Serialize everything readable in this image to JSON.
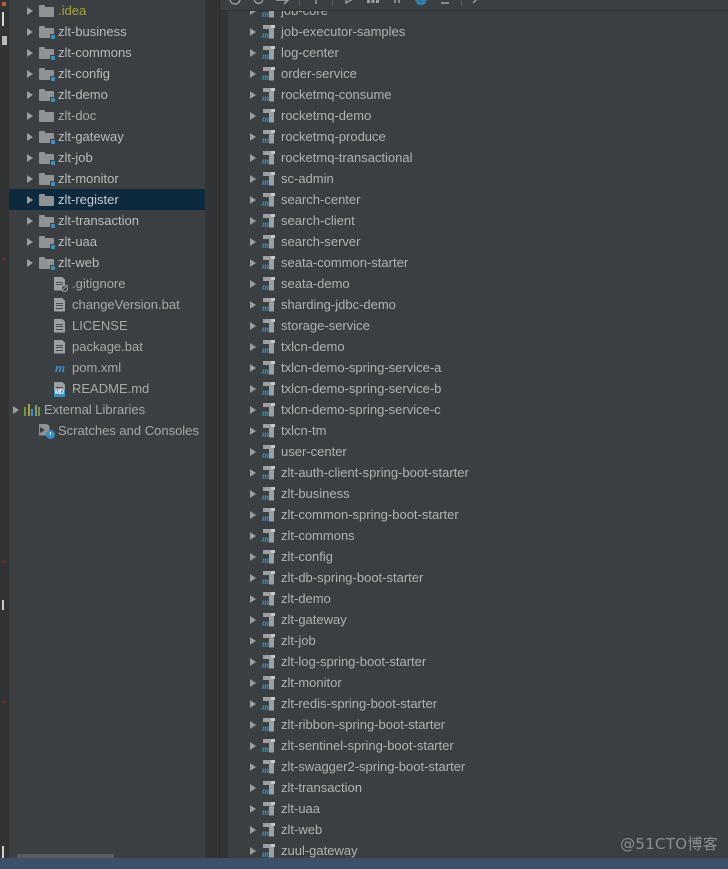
{
  "watermark": "@51CTO博客",
  "left_panel": {
    "name": "project-tree",
    "scrollbar": {
      "orientation": "horizontal"
    },
    "rows": [
      {
        "label": ".idea",
        "icon": "folder-icon",
        "kind": "idea",
        "arrow": true,
        "badge": false,
        "selected": false
      },
      {
        "label": "zlt-business",
        "icon": "folder-module-icon",
        "kind": "dir",
        "arrow": true,
        "badge": true,
        "selected": false
      },
      {
        "label": "zlt-commons",
        "icon": "folder-module-icon",
        "kind": "dir",
        "arrow": true,
        "badge": true,
        "selected": false
      },
      {
        "label": "zlt-config",
        "icon": "folder-module-icon",
        "kind": "dir",
        "arrow": true,
        "badge": true,
        "selected": false
      },
      {
        "label": "zlt-demo",
        "icon": "folder-module-icon",
        "kind": "dir",
        "arrow": true,
        "badge": true,
        "selected": false
      },
      {
        "label": "zlt-doc",
        "icon": "folder-icon",
        "kind": "file",
        "arrow": true,
        "badge": false,
        "selected": false
      },
      {
        "label": "zlt-gateway",
        "icon": "folder-module-icon",
        "kind": "dir",
        "arrow": true,
        "badge": true,
        "selected": false
      },
      {
        "label": "zlt-job",
        "icon": "folder-module-icon",
        "kind": "dir",
        "arrow": true,
        "badge": true,
        "selected": false
      },
      {
        "label": "zlt-monitor",
        "icon": "folder-module-icon",
        "kind": "dir",
        "arrow": true,
        "badge": true,
        "selected": false
      },
      {
        "label": "zlt-register",
        "icon": "folder-icon",
        "kind": "sel",
        "arrow": true,
        "badge": false,
        "selected": true
      },
      {
        "label": "zlt-transaction",
        "icon": "folder-module-icon",
        "kind": "dir",
        "arrow": true,
        "badge": true,
        "selected": false
      },
      {
        "label": "zlt-uaa",
        "icon": "folder-module-icon",
        "kind": "dir",
        "arrow": true,
        "badge": true,
        "selected": false
      },
      {
        "label": "zlt-web",
        "icon": "folder-module-icon",
        "kind": "dir",
        "arrow": true,
        "badge": true,
        "selected": false
      },
      {
        "label": ".gitignore",
        "icon": "gitignore-file-icon",
        "kind": "file",
        "arrow": false,
        "badge": false,
        "selected": false
      },
      {
        "label": "changeVersion.bat",
        "icon": "text-file-icon",
        "kind": "file",
        "arrow": false,
        "badge": false,
        "selected": false
      },
      {
        "label": "LICENSE",
        "icon": "text-file-icon",
        "kind": "file",
        "arrow": false,
        "badge": false,
        "selected": false
      },
      {
        "label": "package.bat",
        "icon": "text-file-icon",
        "kind": "file",
        "arrow": false,
        "badge": false,
        "selected": false
      },
      {
        "label": "pom.xml",
        "icon": "maven-pom-icon",
        "kind": "file",
        "arrow": false,
        "badge": false,
        "selected": false
      },
      {
        "label": "README.md",
        "icon": "markdown-file-icon",
        "kind": "file",
        "arrow": false,
        "badge": false,
        "selected": false
      },
      {
        "label": "External Libraries",
        "icon": "external-libraries-icon",
        "kind": "file",
        "arrow": true,
        "badge": false,
        "selected": false,
        "root": true
      },
      {
        "label": "Scratches and Consoles",
        "icon": "scratches-icon",
        "kind": "file",
        "arrow": false,
        "badge": false,
        "selected": false,
        "root": true
      }
    ]
  },
  "right_panel": {
    "name": "maven-projects-tool-window",
    "toolbar": {
      "buttons": [
        {
          "name": "reimport-icon"
        },
        {
          "name": "generate-sources-icon"
        },
        {
          "name": "download-sources-icon"
        },
        {
          "name": "add-icon"
        },
        {
          "name": "run-icon"
        },
        {
          "name": "toggle-skip-tests-icon"
        },
        {
          "name": "toggle-offline-icon"
        },
        {
          "name": "show-dependencies-icon"
        },
        {
          "name": "collapse-all-icon"
        },
        {
          "name": "settings-icon"
        }
      ]
    },
    "rows": [
      {
        "label": "job-core",
        "partial": true
      },
      {
        "label": "job-executor-samples"
      },
      {
        "label": "log-center"
      },
      {
        "label": "order-service"
      },
      {
        "label": "rocketmq-consume"
      },
      {
        "label": "rocketmq-demo"
      },
      {
        "label": "rocketmq-produce"
      },
      {
        "label": "rocketmq-transactional"
      },
      {
        "label": "sc-admin"
      },
      {
        "label": "search-center"
      },
      {
        "label": "search-client"
      },
      {
        "label": "search-server"
      },
      {
        "label": "seata-common-starter"
      },
      {
        "label": "seata-demo"
      },
      {
        "label": "sharding-jdbc-demo"
      },
      {
        "label": "storage-service"
      },
      {
        "label": "txlcn-demo"
      },
      {
        "label": "txlcn-demo-spring-service-a"
      },
      {
        "label": "txlcn-demo-spring-service-b"
      },
      {
        "label": "txlcn-demo-spring-service-c"
      },
      {
        "label": "txlcn-tm"
      },
      {
        "label": "user-center"
      },
      {
        "label": "zlt-auth-client-spring-boot-starter"
      },
      {
        "label": "zlt-business"
      },
      {
        "label": "zlt-common-spring-boot-starter"
      },
      {
        "label": "zlt-commons"
      },
      {
        "label": "zlt-config"
      },
      {
        "label": "zlt-db-spring-boot-starter"
      },
      {
        "label": "zlt-demo"
      },
      {
        "label": "zlt-gateway"
      },
      {
        "label": "zlt-job"
      },
      {
        "label": "zlt-log-spring-boot-starter"
      },
      {
        "label": "zlt-monitor"
      },
      {
        "label": "zlt-redis-spring-boot-starter"
      },
      {
        "label": "zlt-ribbon-spring-boot-starter"
      },
      {
        "label": "zlt-sentinel-spring-boot-starter"
      },
      {
        "label": "zlt-swagger2-spring-boot-starter"
      },
      {
        "label": "zlt-transaction"
      },
      {
        "label": "zlt-uaa"
      },
      {
        "label": "zlt-web"
      },
      {
        "label": "zuul-gateway"
      }
    ]
  },
  "colors": {
    "panel_bg": "#3c3f41",
    "rail_bg": "#313335",
    "selection_bg": "#0d293e",
    "text": "#a9b7c6",
    "accent_blue": "#3592c4",
    "idea_yellow": "#a5a539",
    "status_bar": "#3c5069"
  }
}
